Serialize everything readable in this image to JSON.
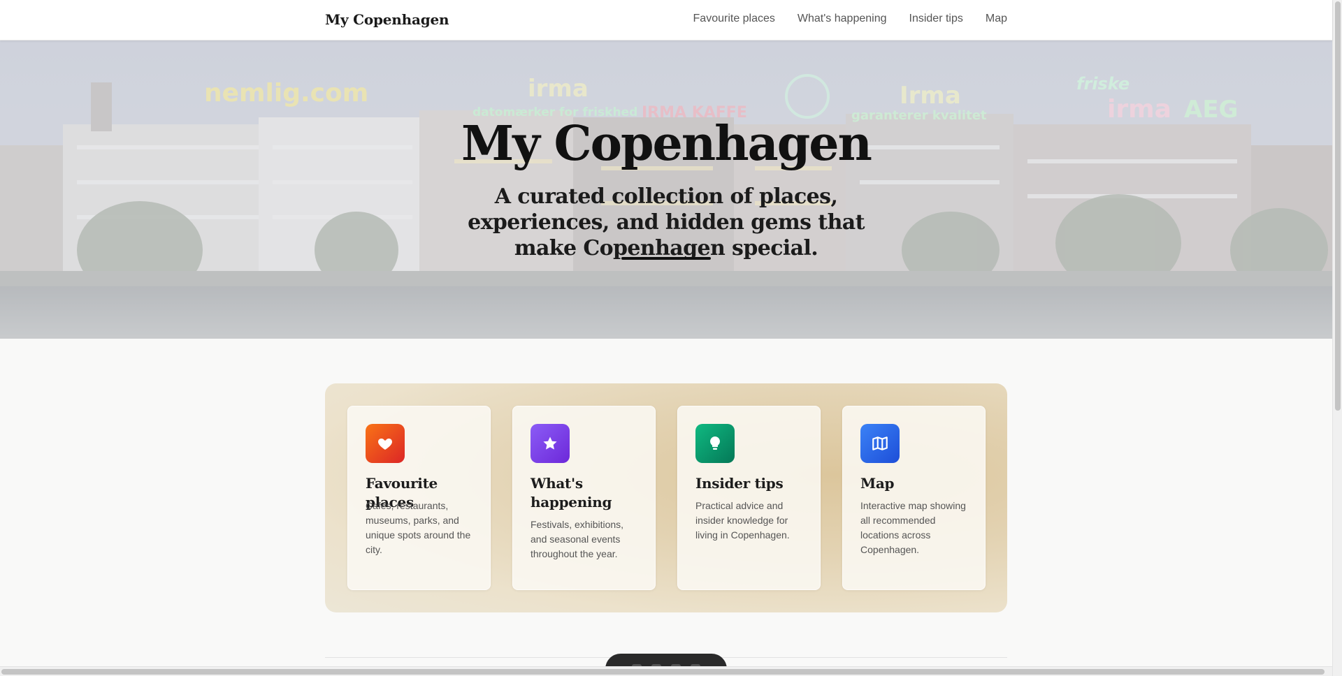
{
  "header": {
    "brand": "My Copenhagen",
    "nav": [
      {
        "label": "Favourite places"
      },
      {
        "label": "What's happening"
      },
      {
        "label": "Insider tips"
      },
      {
        "label": "Map"
      }
    ]
  },
  "hero": {
    "title": "My Copenhagen",
    "subtitle": "A curated collection of places, experiences, and hidden gems that make Copenhagen special.",
    "neon_signs": [
      "nemlig.com",
      "irma",
      "datomærker for friskhed",
      "IRMA KAFFE",
      "Irma",
      "garanterer kvalitet",
      "friske",
      "irma",
      "AEG"
    ]
  },
  "cards": [
    {
      "title": "Favourite places",
      "description": "Cafés, restaurants, museums, parks, and unique spots around the city.",
      "icon": "heart-icon",
      "color": "#ea580c"
    },
    {
      "title": "What's happening",
      "description": "Festivals, exhibitions, and seasonal events throughout the year.",
      "icon": "star-icon",
      "color": "#7c3aed"
    },
    {
      "title": "Insider tips",
      "description": "Practical advice and insider knowledge for living in Copenhagen.",
      "icon": "lightbulb-icon",
      "color": "#059669"
    },
    {
      "title": "Map",
      "description": "Interactive map showing all recommended locations across Copenhagen.",
      "icon": "map-icon",
      "color": "#2563eb"
    }
  ]
}
